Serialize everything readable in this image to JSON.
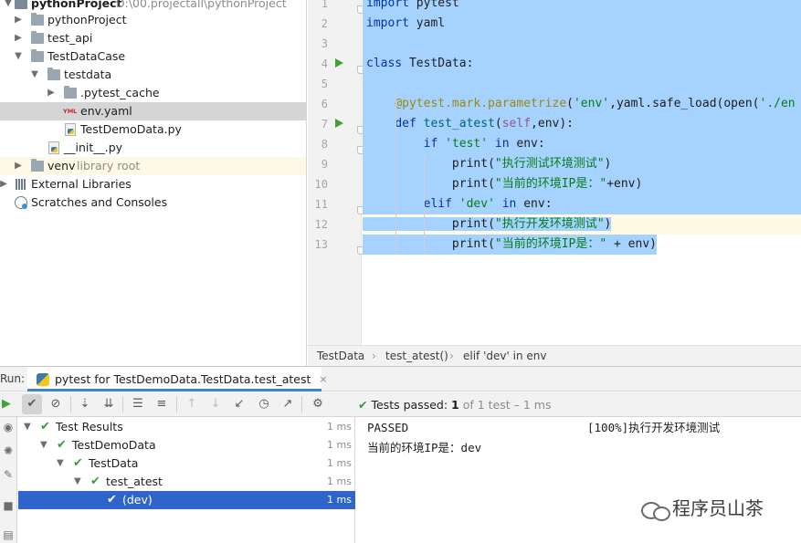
{
  "project_tree": {
    "root": {
      "name": "pythonProject",
      "path": "D:\\00.projectall\\pythonProject"
    },
    "items": [
      {
        "label": "pythonProject",
        "suffix": ""
      },
      {
        "label": "test_api",
        "suffix": ""
      },
      {
        "label": "TestDataCase",
        "suffix": ""
      },
      {
        "label": "testdata",
        "suffix": ""
      },
      {
        "label": ".pytest_cache",
        "suffix": ""
      },
      {
        "label": "env.yaml",
        "suffix": "",
        "icon_text": "YML"
      },
      {
        "label": "TestDemoData.py",
        "suffix": ""
      },
      {
        "label": "__init__.py",
        "suffix": ""
      },
      {
        "label": "venv",
        "suffix": "library root"
      },
      {
        "label": "External Libraries",
        "suffix": ""
      },
      {
        "label": "Scratches and Consoles",
        "suffix": ""
      }
    ]
  },
  "editor": {
    "line_numbers": [
      "1",
      "2",
      "3",
      "4",
      "5",
      "6",
      "7",
      "8",
      "9",
      "10",
      "11",
      "12",
      "13"
    ],
    "code": {
      "l1_kw": "import",
      "l1_rest": " pytest",
      "l2_kw": "import",
      "l2_rest": " yaml",
      "l4_kw": "class",
      "l4_rest": " TestData:",
      "l6_deco": "@pytest.mark.parametrize",
      "l6_p1": "(",
      "l6_str1": "'env'",
      "l6_p2": ",yaml.safe_load(open(",
      "l6_str2": "'./en",
      "l7_kw": "def",
      "l7_sp": " ",
      "l7_fn": "test_atest",
      "l7_p1": "(",
      "l7_self": "self",
      "l7_p2": ",env):",
      "l8_kw": "if",
      "l8_sp": " ",
      "l8_str": "'test'",
      "l8_sp2": " ",
      "l8_kw2": "in",
      "l8_rest": " env:",
      "l9_fn": "print",
      "l9_p1": "(",
      "l9_str": "\"执行测试环境测试\"",
      "l9_p2": ")",
      "l10_fn": "print",
      "l10_p1": "(",
      "l10_str": "\"当前的环境IP是：\"",
      "l10_p2": "+env)",
      "l11_kw": "elif",
      "l11_sp": " ",
      "l11_str": "'dev'",
      "l11_sp2": " ",
      "l11_kw2": "in",
      "l11_rest": " env:",
      "l12_fn": "print",
      "l12_p1": "(",
      "l12_str": "\"执行开发环境测试\"",
      "l12_p2": ")",
      "l13_fn": "print",
      "l13_p1": "(",
      "l13_str": "\"当前的环境IP是：\"",
      "l13_p2": " + env)"
    }
  },
  "breadcrumb": [
    "TestData",
    "test_atest()",
    "elif 'dev' in env"
  ],
  "run_panel": {
    "label": "Run:",
    "tab_title": "pytest for TestDemoData.TestData.test_atest",
    "tab_close": "×",
    "status": {
      "prefix": "Tests passed: ",
      "count": "1",
      "rest": " of 1 test – 1 ms"
    },
    "toolbar_icons": [
      "show-passed-icon",
      "show-ignored-icon",
      "sort-alpha-icon",
      "sort-duration-icon",
      "expand-all-icon",
      "collapse-all-icon",
      "previous-test-icon",
      "next-test-icon",
      "import-tests-icon",
      "test-history-icon",
      "export-results-icon",
      "settings-icon"
    ],
    "tests": [
      {
        "name": "Test Results",
        "time": "1 ms"
      },
      {
        "name": "TestDemoData",
        "time": "1 ms"
      },
      {
        "name": "TestData",
        "time": "1 ms"
      },
      {
        "name": "test_atest",
        "time": "1 ms"
      },
      {
        "name": "(dev)",
        "time": "1 ms"
      }
    ],
    "console": [
      {
        "left": "PASSED",
        "right": "[100%]执行开发环境测试"
      },
      {
        "left": "当前的环境IP是：dev",
        "right": ""
      }
    ]
  },
  "watermark": {
    "text": "程序员山茶"
  },
  "colors": {
    "selection": "#a6d2ff",
    "current_line": "#fffae3",
    "tree_selected": "#2f65ca",
    "pass_green": "#3c9a3c",
    "keyword": "#0033b3",
    "string": "#067d17"
  }
}
